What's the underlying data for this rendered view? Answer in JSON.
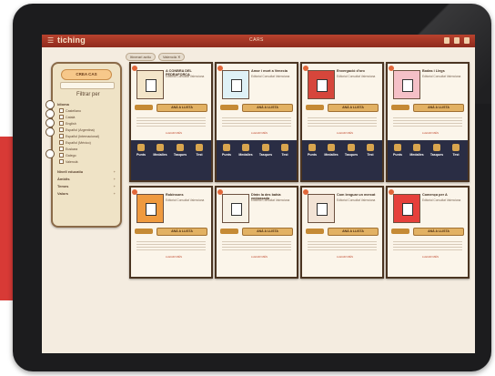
{
  "app": {
    "logo": "tiching",
    "title": "CARS"
  },
  "filters": {
    "create_button": "CREA CAS",
    "title": "Filtrar per",
    "sections": [
      {
        "label": "Idioma"
      },
      {
        "label": "Nivell educatiu"
      },
      {
        "label": "Àmbits"
      },
      {
        "label": "Temes"
      },
      {
        "label": "Valors"
      }
    ],
    "languages": [
      "Castellano",
      "Català",
      "English",
      "Español (Argentina)",
      "Español (Internacional)",
      "Español (México)",
      "Euskara",
      "Galego",
      "Valencià"
    ]
  },
  "chips": [
    {
      "label": "Itinerari actiu"
    },
    {
      "label": "Valencià ✕"
    }
  ],
  "cards": [
    {
      "title": "A CONBRA DEL PEDRAFORCA",
      "subtitle": "Editorial Consultat Valenciana",
      "cta": "ANÀ A LLISTA",
      "more": "LLEGIR MÉS"
    },
    {
      "title": "Amor i mort a Venecia",
      "subtitle": "Editorial Consultat Valenciana",
      "cta": "ANÀ A LLISTA",
      "more": "LLEGIR MÉS"
    },
    {
      "title": "Enxergació d'oro",
      "subtitle": "Editorial Consultat Valenciana",
      "cta": "ANÀ A LLISTA",
      "more": "LLEGIR MÉS"
    },
    {
      "title": "Bodas i Llegs",
      "subtitle": "Editorial Consultat Valenciana",
      "cta": "ANÀ A LLISTA",
      "more": "LLEGIR MÉS"
    },
    {
      "title": "Robinsons",
      "subtitle": "Editorial Consultat Valenciana",
      "cta": "ANÀ A LLISTA",
      "more": "LLEGIR MÉS"
    },
    {
      "title": "Dirán la des bahía embrasada",
      "subtitle": "Editorial Consultat Valenciana",
      "cta": "ANÀ A LLISTA",
      "more": "LLEGIR MÉS"
    },
    {
      "title": "Com lenguar un mercat",
      "subtitle": "Editorial Consultat Valenciana",
      "cta": "ANÀ A LLISTA",
      "more": "LLEGIR MÉS"
    },
    {
      "title": "Comença per A",
      "subtitle": "Editorial Consultat Valenciana",
      "cta": "ANÀ A LLISTA",
      "more": "LLEGIR MÉS"
    }
  ],
  "stats_labels": [
    "Punts",
    "Medalles",
    "Tasques",
    "Test"
  ]
}
